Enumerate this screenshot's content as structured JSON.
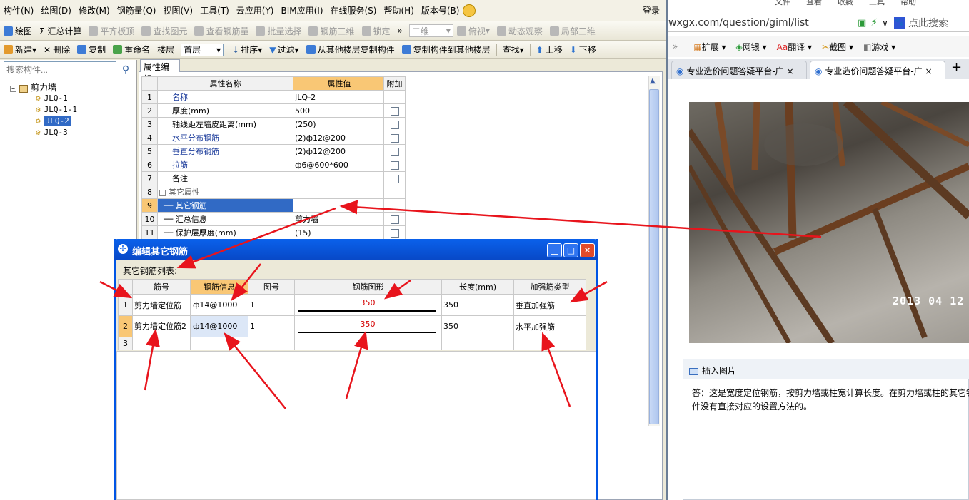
{
  "app": {
    "menu": [
      "构件(N)",
      "绘图(D)",
      "修改(M)",
      "钢筋量(Q)",
      "视图(V)",
      "工具(T)",
      "云应用(Y)",
      "BIM应用(I)",
      "在线服务(S)",
      "帮助(H)",
      "版本号(B)"
    ],
    "login": "登录",
    "toolbar1": {
      "draw": "绘图",
      "sum_calc": "Σ 汇总计算",
      "flat_top": "平齐板顶",
      "find_element": "查找图元",
      "view_rebar": "查看钢筋量",
      "batch_select": "批量选择",
      "rebar_3d": "钢筋三维",
      "lock": "锁定",
      "view_mode": "二维",
      "top_view": "俯视",
      "dynamic_view": "动态观察",
      "local_3d": "局部三维",
      "more": "»"
    },
    "toolbar2": {
      "new": "新建",
      "delete": "删除",
      "copy": "复制",
      "rename": "重命名",
      "floor_label": "楼层",
      "floor_value": "首层",
      "sort": "排序",
      "filter": "过滤",
      "copy_from_floor": "从其他楼层复制构件",
      "copy_to_floor": "复制构件到其他楼层",
      "find": "查找",
      "move_up": "上移",
      "move_down": "下移"
    },
    "tree": {
      "search_placeholder": "搜索构件...",
      "root": "剪力墙",
      "items": [
        "JLQ-1",
        "JLQ-1-1",
        "JLQ-2",
        "JLQ-3"
      ],
      "selected": "JLQ-2"
    },
    "prop_tab": "属性编辑",
    "prop_table": {
      "headers": [
        "属性名称",
        "属性值",
        "附加"
      ],
      "rows": [
        {
          "no": "1",
          "name": "名称",
          "value": "JLQ-2",
          "checkbox": false
        },
        {
          "no": "2",
          "name": "厚度(mm)",
          "value": "500",
          "checkbox": true
        },
        {
          "no": "3",
          "name": "轴线距左墙皮距离(mm)",
          "value": "(250)",
          "checkbox": true
        },
        {
          "no": "4",
          "name": "水平分布钢筋",
          "value": "(2)ф12@200",
          "checkbox": true
        },
        {
          "no": "5",
          "name": "垂直分布钢筋",
          "value": "(2)ф12@200",
          "checkbox": true
        },
        {
          "no": "6",
          "name": "拉筋",
          "value": "ф6@600*600",
          "checkbox": true
        },
        {
          "no": "7",
          "name": "备注",
          "value": "",
          "checkbox": true
        },
        {
          "no": "8",
          "name": "其它属性",
          "value": "",
          "checkbox": false
        },
        {
          "no": "9",
          "name": "其它钢筋",
          "value": "",
          "checkbox": false
        },
        {
          "no": "10",
          "name": "汇总信息",
          "value": "剪力墙",
          "checkbox": true
        },
        {
          "no": "11",
          "name": "保护层厚度(mm)",
          "value": "(15)",
          "checkbox": true
        }
      ]
    }
  },
  "dialog": {
    "title": "编辑其它钢筋",
    "list_label": "其它钢筋列表:",
    "headers": [
      "筋号",
      "钢筋信息",
      "图号",
      "钢筋图形",
      "长度(mm)",
      "加强筋类型"
    ],
    "rows": [
      {
        "no": "1",
        "name": "剪力墙定位筋",
        "info": "ф14@1000",
        "fig": "1",
        "shape": "350",
        "length": "350",
        "type": "垂直加强筋"
      },
      {
        "no": "2",
        "name": "剪力墙定位筋2",
        "info": "ф14@1000",
        "fig": "1",
        "shape": "350",
        "length": "350",
        "type": "水平加强筋"
      },
      {
        "no": "3",
        "name": "",
        "info": "",
        "fig": "",
        "shape": "",
        "length": "",
        "type": ""
      }
    ]
  },
  "browser": {
    "top_menu": [
      "文件",
      "查看",
      "收藏",
      "工具",
      "帮助"
    ],
    "url": "wxgx.com/question/giml/list",
    "search_placeholder": "点此搜索",
    "bookmarks": [
      "扩展",
      "网银",
      "翻译",
      "截图",
      "游戏"
    ],
    "tabs": [
      "专业造价问题答疑平台-广",
      "专业造价问题答疑平台-广"
    ],
    "photo_date": "2013 04 12",
    "insert_image": "插入图片",
    "answer_line1": "答：这是宽度定位钢筋，按剪力墙或柱宽计算长度。在剪力墙或柱的其它钢",
    "answer_line2": "件没有直接对应的设置方法的。"
  },
  "colors": {
    "arrow": "#E8141C",
    "selection": "#316AC5",
    "header_highlight": "#F9C775",
    "dialog_title": "#0A61EB"
  }
}
